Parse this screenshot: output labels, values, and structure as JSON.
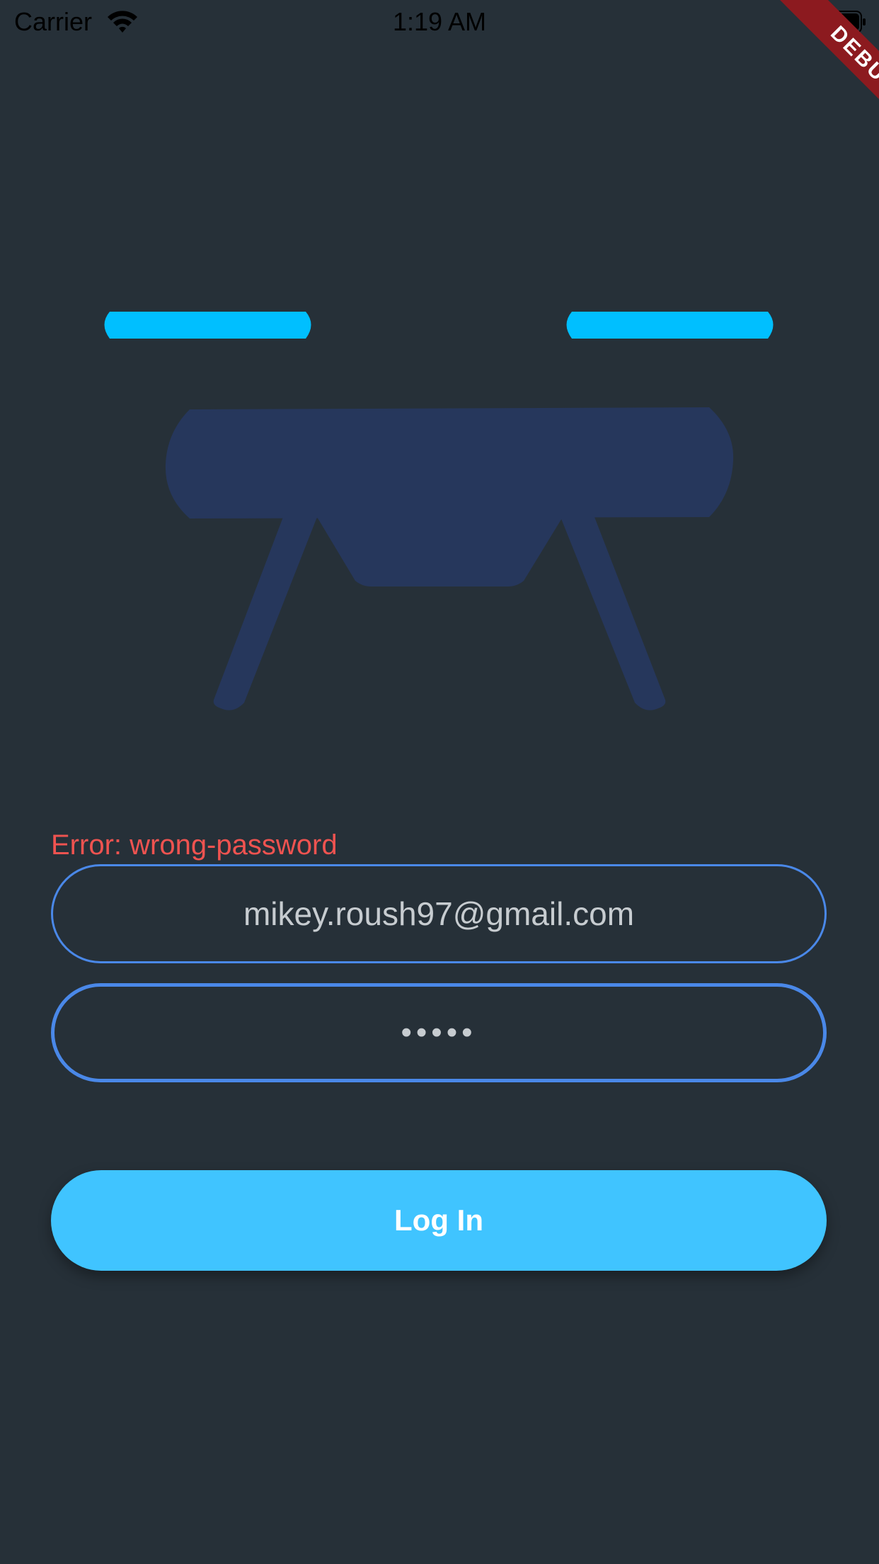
{
  "status_bar": {
    "carrier": "Carrier",
    "time": "1:19 AM"
  },
  "debug_banner": {
    "label": "DEBUG"
  },
  "login": {
    "error": "Error: wrong-password",
    "email_value": "mikey.roush97@gmail.com",
    "password_value": "•••••",
    "login_label": "Log In"
  },
  "colors": {
    "background": "#263038",
    "accent": "#40c4ff",
    "drone_body": "#26375c",
    "propeller": "#00bfff",
    "field_border": "#4a88e8",
    "error": "#ef5350"
  }
}
